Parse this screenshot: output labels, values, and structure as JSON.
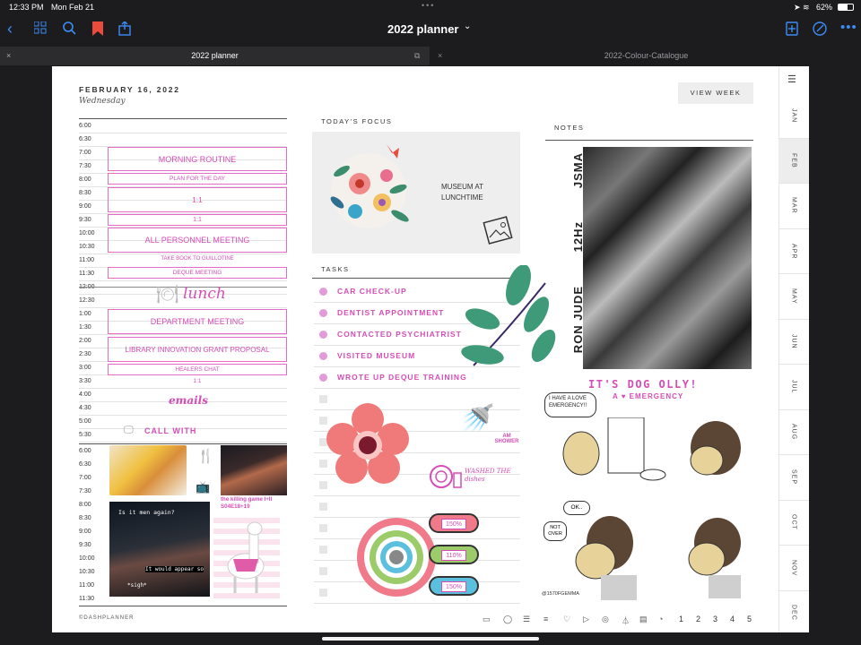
{
  "status": {
    "time": "12:33 PM",
    "date": "Mon Feb 21",
    "battery": "62%"
  },
  "toolbar": {
    "title": "2022 planner",
    "chevron": "⌄"
  },
  "tabs": [
    {
      "label": "2022 planner"
    },
    {
      "label": "2022-Colour-Catalogue"
    }
  ],
  "header": {
    "date": "FEBRUARY 16, 2022",
    "weekday": "Wednesday",
    "view_week": "VIEW WEEK"
  },
  "schedule": {
    "hours": [
      "6:00",
      "6:30",
      "7:00",
      "7:30",
      "8:00",
      "8:30",
      "9:00",
      "9:30",
      "10:00",
      "10:30",
      "11:00",
      "11:30",
      "12:00",
      "12:30",
      "1:00",
      "1:30",
      "2:00",
      "2:30",
      "3:00",
      "3:30",
      "4:00",
      "4:30",
      "5:00",
      "5:30"
    ],
    "evening_hours": [
      "6:00",
      "6:30",
      "7:00",
      "7:30",
      "8:00",
      "8:30",
      "9:00",
      "9:30",
      "10:00",
      "10:30",
      "11:00",
      "11:30"
    ],
    "events": [
      "MORNING ROUTINE",
      "PLAN FOR THE DAY",
      "1:1",
      "1:1",
      "ALL PERSONNEL MEETING",
      "TAKE BOOK TO GUILLOTINE",
      "DEQUE MEETING",
      "DEPARTMENT MEETING",
      "LIBRARY INNOVATION GRANT PROPOSAL",
      "HEALERS CHAT",
      "1:1"
    ],
    "lunch": "lunch",
    "emails": "emails",
    "call": "CALL WITH",
    "tv_caption": "the killing game I+II S04E18+19",
    "meme_text1": "Is it men again?",
    "meme_text2": "It would appear so",
    "meme_text3": "*sigh*"
  },
  "focus": {
    "label": "TODAY'S FOCUS",
    "text": "MUSEUM AT LUNCHTIME"
  },
  "tasks": {
    "label": "TASKS",
    "items": [
      "CAR CHECK-UP",
      "DENTIST APPOINTMENT",
      "CONTACTED PSYCHIATRIST",
      "VISITED MUSEUM",
      "WROTE UP DEQUE TRAINING"
    ],
    "shower": "AM SHOWER",
    "dishes": "WASHED THE dishes",
    "progress": [
      {
        "text": "150%",
        "value": 150
      },
      {
        "text": "110%",
        "value": 110
      },
      {
        "text": "150%",
        "value": 150
      }
    ]
  },
  "notes": {
    "label": "NOTES",
    "sticker_lines": [
      "JSMA",
      "12Hz",
      "RON JUDE"
    ],
    "dog_title": "IT'S DOG OLLY!",
    "dog_sub": "A ♥ EMERGENCY",
    "bubble1": "I HAVE A LOVE EMERGENCY!!",
    "bubble2": "OK..",
    "bubble3": "NOT OVER",
    "handle": "@1570FGEMMA"
  },
  "months": [
    "JAN",
    "FEB",
    "MAR",
    "APR",
    "MAY",
    "JUN",
    "JUL",
    "AUG",
    "SEP",
    "OCT",
    "NOV",
    "DEC"
  ],
  "footer": {
    "brand": "©DASHPLANNER",
    "pages": [
      "1",
      "2",
      "3",
      "4",
      "5"
    ]
  },
  "colors": {
    "pink": "#d64db6",
    "accent": "#3d8cf6"
  }
}
